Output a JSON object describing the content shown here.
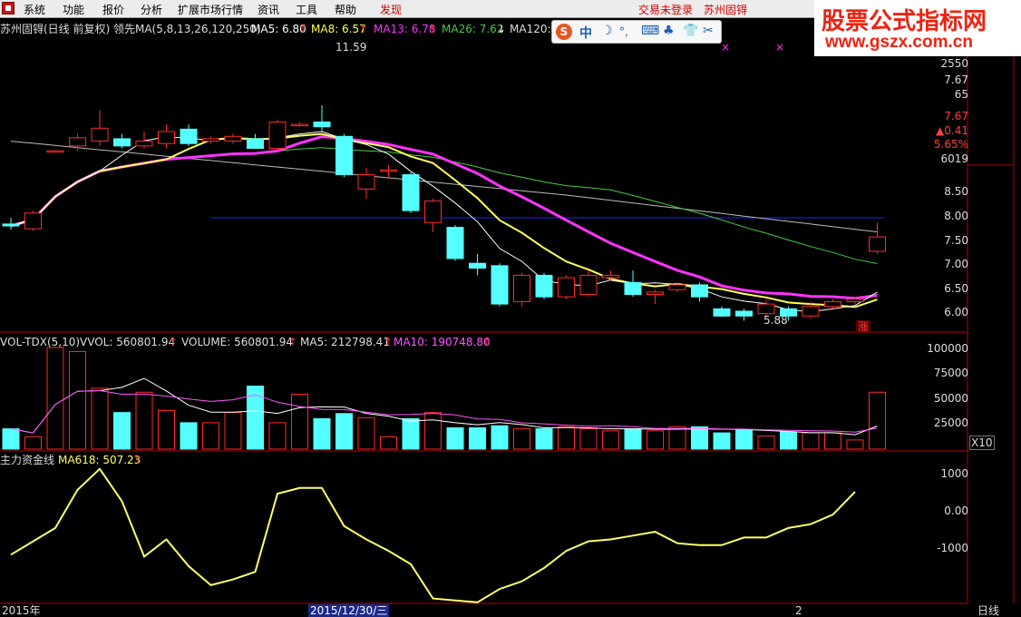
{
  "menu": {
    "items": [
      "系统",
      "功能",
      "报价",
      "分析",
      "扩展市场行情",
      "资讯",
      "工具",
      "帮助",
      "发现"
    ],
    "status_login": "交易未登录",
    "stock_name_top": "苏州固锝"
  },
  "watermark": {
    "line1": "股票公式指标网",
    "line2": "www.gszx.com.cn"
  },
  "ime": {
    "logo": "S",
    "lang": "中",
    "glyphs": [
      "☽",
      "°,",
      "⌨",
      "♣",
      "👕",
      "✂"
    ]
  },
  "main_legend": {
    "title": "苏州固锝(日线 前复权) 领先MA(5,8,13,26,120,250)",
    "ma5": "MA5: 6.80",
    "ma8": "MA8: 6.57",
    "ma13": "MA13: 6.78",
    "ma26": "MA26: 7.62",
    "ma120": "MA120: 9",
    "high_label": "11.59",
    "low_label": "5.88",
    "zhang": "涨"
  },
  "vol_legend": {
    "title": "VOL-TDX(5,10)",
    "vvol": "VVOL: 560801.94",
    "volume": "VOLUME: 560801.94",
    "ma5": "MA5: 212798.41",
    "ma10": "MA10: 190748.80",
    "x10": "X10"
  },
  "fund_legend": {
    "title": "主力资金线",
    "ma618": "MA618: 507.23"
  },
  "right_axis": {
    "top_info": [
      "2550",
      "7.67",
      "65",
      "7.67",
      "▲0.41",
      "5.65%",
      "6019"
    ],
    "price_ticks": [
      "8.50",
      "8.00",
      "7.50",
      "7.00",
      "6.50",
      "6.00"
    ],
    "vol_ticks": [
      "100000",
      "75000",
      "50000",
      "25000"
    ],
    "fund_ticks": [
      "1000",
      "0.00",
      "-1000"
    ]
  },
  "bottom_axis": {
    "year": "2015年",
    "date": "2015/12/30/三",
    "mark": "2",
    "period": "日线"
  },
  "colors": {
    "up": "#ff2a2a",
    "down": "#54ffff",
    "ma5": "#ffffff",
    "ma8": "#ffff55",
    "ma13": "#ff33ff",
    "ma26": "#44cc44",
    "ma120": "#bbbbbb",
    "ma250": "#2222ff",
    "fund": "#ffff66",
    "frame": "#b80000"
  },
  "chart_data": {
    "type": "candlestick",
    "candles": [
      {
        "o": 7.82,
        "c": 7.78,
        "h": 7.95,
        "l": 7.7
      },
      {
        "o": 7.72,
        "c": 8.05,
        "h": 8.1,
        "l": 7.68
      },
      {
        "o": 9.35,
        "c": 9.35,
        "h": 9.35,
        "l": 9.35
      },
      {
        "o": 9.45,
        "c": 9.62,
        "h": 9.7,
        "l": 9.35
      },
      {
        "o": 9.55,
        "c": 9.82,
        "h": 10.2,
        "l": 9.45
      },
      {
        "o": 9.6,
        "c": 9.45,
        "h": 9.7,
        "l": 9.4
      },
      {
        "o": 9.45,
        "c": 9.55,
        "h": 9.75,
        "l": 9.4
      },
      {
        "o": 9.5,
        "c": 9.75,
        "h": 9.9,
        "l": 9.4
      },
      {
        "o": 9.8,
        "c": 9.5,
        "h": 9.9,
        "l": 9.45
      },
      {
        "o": 9.55,
        "c": 9.6,
        "h": 9.65,
        "l": 9.5
      },
      {
        "o": 9.55,
        "c": 9.65,
        "h": 9.7,
        "l": 9.5
      },
      {
        "o": 9.6,
        "c": 9.4,
        "h": 9.7,
        "l": 9.4
      },
      {
        "o": 9.4,
        "c": 9.95,
        "h": 10.0,
        "l": 9.35
      },
      {
        "o": 9.9,
        "c": 9.9,
        "h": 9.95,
        "l": 9.85
      },
      {
        "o": 9.95,
        "c": 9.85,
        "h": 10.3,
        "l": 9.75
      },
      {
        "o": 9.65,
        "c": 8.85,
        "h": 9.7,
        "l": 8.8
      },
      {
        "o": 8.55,
        "c": 8.85,
        "h": 9.0,
        "l": 8.35
      },
      {
        "o": 8.95,
        "c": 8.95,
        "h": 9.05,
        "l": 8.8
      },
      {
        "o": 8.85,
        "c": 8.1,
        "h": 8.9,
        "l": 8.05
      },
      {
        "o": 7.85,
        "c": 8.3,
        "h": 8.35,
        "l": 7.65
      },
      {
        "o": 7.75,
        "c": 7.1,
        "h": 7.8,
        "l": 7.05
      },
      {
        "o": 7.0,
        "c": 6.9,
        "h": 7.2,
        "l": 6.75
      },
      {
        "o": 6.95,
        "c": 6.15,
        "h": 7.0,
        "l": 6.1
      },
      {
        "o": 6.2,
        "c": 6.75,
        "h": 6.8,
        "l": 6.1
      },
      {
        "o": 6.75,
        "c": 6.3,
        "h": 6.8,
        "l": 6.25
      },
      {
        "o": 6.3,
        "c": 6.7,
        "h": 6.75,
        "l": 6.25
      },
      {
        "o": 6.35,
        "c": 6.75,
        "h": 6.85,
        "l": 6.3
      },
      {
        "o": 6.7,
        "c": 6.75,
        "h": 6.85,
        "l": 6.65
      },
      {
        "o": 6.6,
        "c": 6.35,
        "h": 6.85,
        "l": 6.3
      },
      {
        "o": 6.35,
        "c": 6.4,
        "h": 6.45,
        "l": 6.15
      },
      {
        "o": 6.45,
        "c": 6.55,
        "h": 6.6,
        "l": 6.4
      },
      {
        "o": 6.55,
        "c": 6.3,
        "h": 6.6,
        "l": 6.2
      },
      {
        "o": 6.05,
        "c": 5.9,
        "h": 6.1,
        "l": 5.88
      },
      {
        "o": 6.0,
        "c": 5.9,
        "h": 6.05,
        "l": 5.8
      },
      {
        "o": 5.95,
        "c": 6.15,
        "h": 6.25,
        "l": 5.9
      },
      {
        "o": 6.05,
        "c": 5.9,
        "h": 6.1,
        "l": 5.8
      },
      {
        "o": 5.9,
        "c": 6.1,
        "h": 6.2,
        "l": 5.85
      },
      {
        "o": 6.1,
        "c": 6.2,
        "h": 6.25,
        "l": 6.05
      },
      {
        "o": 6.2,
        "c": 6.25,
        "h": 6.3,
        "l": 6.15
      },
      {
        "o": 7.25,
        "c": 7.55,
        "h": 7.85,
        "l": 7.2
      }
    ],
    "volumes": [
      20000,
      12000,
      100000,
      96000,
      60000,
      36000,
      56000,
      38000,
      26000,
      26000,
      36000,
      62000,
      26000,
      54000,
      30000,
      35000,
      31000,
      12000,
      30000,
      36000,
      21000,
      21000,
      23000,
      20000,
      20000,
      22000,
      20000,
      18000,
      20000,
      18000,
      22000,
      22000,
      16000,
      19000,
      13000,
      17000,
      16000,
      16000,
      9000,
      56000
    ],
    "fund_line": [
      -1150,
      -800,
      -450,
      550,
      1100,
      250,
      -1200,
      -750,
      -1450,
      -1950,
      -1800,
      -1600,
      450,
      600,
      600,
      -400,
      -750,
      -1050,
      -1400,
      -2300,
      -2350,
      -2400,
      -2050,
      -1850,
      -1500,
      -1050,
      -800,
      -750,
      -650,
      -550,
      -850,
      -900,
      -900,
      -700,
      -700,
      -450,
      -350,
      -100,
      500
    ]
  }
}
